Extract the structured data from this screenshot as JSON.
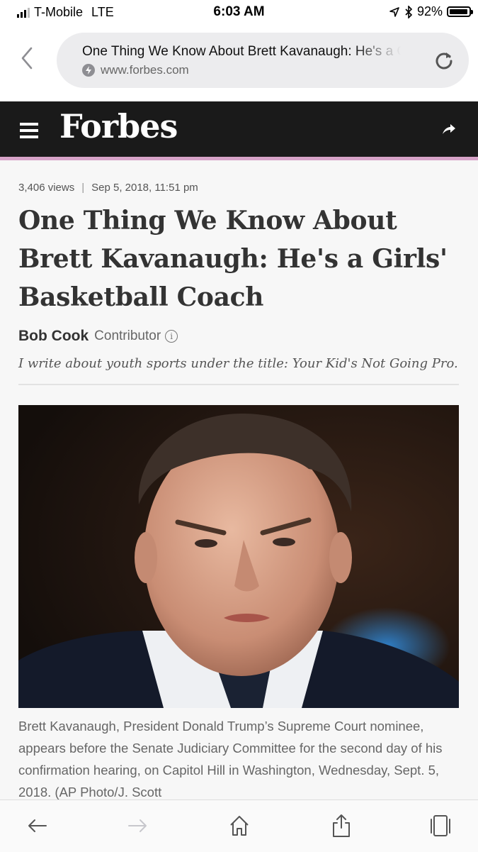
{
  "status_bar": {
    "carrier": "T-Mobile",
    "network": "LTE",
    "time": "6:03 AM",
    "battery": "92%"
  },
  "browser": {
    "page_title": "One Thing We Know About Brett Kavanaugh: He's a Girls' Basketball Coach",
    "domain": "www.forbes.com"
  },
  "site": {
    "logo": "Forbes",
    "accent_color": "#d7a3c8",
    "bar_color": "#1a1a1a"
  },
  "article": {
    "views": "3,406 views",
    "separator": "|",
    "date": "Sep 5, 2018, 11:51 pm",
    "headline": "One Thing We Know About Brett Kavanaugh: He's a Girls' Basketball Coach",
    "author": "Bob Cook",
    "author_role": "Contributor",
    "info_glyph": "i",
    "bio": "I write about youth sports under the title: Your Kid's Not Going Pro.",
    "caption": "Brett Kavanaugh, President Donald Trump’s Supreme Court nominee, appears before the Senate Judiciary Committee for the second day of his confirmation hearing, on Capitol Hill in Washington, Wednesday, Sept. 5, 2018. (AP Photo/J. Scott"
  },
  "toolbar": {
    "icons": [
      "back-arrow-icon",
      "forward-arrow-icon",
      "home-icon",
      "share-icon",
      "tabs-icon"
    ]
  }
}
